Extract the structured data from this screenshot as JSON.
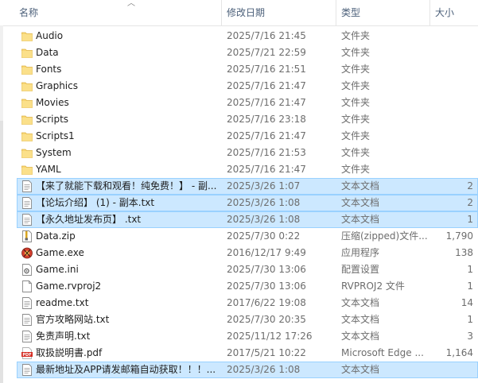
{
  "columns": {
    "name": "名称",
    "date": "修改日期",
    "type": "类型",
    "size": "大小"
  },
  "colors": {
    "selection_fill": "#cce8ff",
    "selection_border": "#99d1ff",
    "folder": "#f8d775",
    "pdf": "#d4281e"
  },
  "files": [
    {
      "name": "Audio",
      "date": "2025/7/16 21:45",
      "type": "文件夹",
      "size": "",
      "icon": "folder-icon",
      "selected": false
    },
    {
      "name": "Data",
      "date": "2025/7/21 22:59",
      "type": "文件夹",
      "size": "",
      "icon": "folder-icon",
      "selected": false
    },
    {
      "name": "Fonts",
      "date": "2025/7/16 21:51",
      "type": "文件夹",
      "size": "",
      "icon": "folder-icon",
      "selected": false
    },
    {
      "name": "Graphics",
      "date": "2025/7/16 21:47",
      "type": "文件夹",
      "size": "",
      "icon": "folder-icon",
      "selected": false
    },
    {
      "name": "Movies",
      "date": "2025/7/16 21:47",
      "type": "文件夹",
      "size": "",
      "icon": "folder-icon",
      "selected": false
    },
    {
      "name": "Scripts",
      "date": "2025/7/16 23:18",
      "type": "文件夹",
      "size": "",
      "icon": "folder-icon",
      "selected": false
    },
    {
      "name": "Scripts1",
      "date": "2025/7/16 21:47",
      "type": "文件夹",
      "size": "",
      "icon": "folder-icon",
      "selected": false
    },
    {
      "name": "System",
      "date": "2025/7/16 21:53",
      "type": "文件夹",
      "size": "",
      "icon": "folder-icon",
      "selected": false
    },
    {
      "name": "YAML",
      "date": "2025/7/16 21:47",
      "type": "文件夹",
      "size": "",
      "icon": "folder-icon",
      "selected": false
    },
    {
      "name": "【来了就能下载和观看！纯免费！】 - 副...",
      "date": "2025/3/26 1:07",
      "type": "文本文档",
      "size": "2",
      "icon": "text-file-icon",
      "selected": true
    },
    {
      "name": "【论坛介绍】 (1) - 副本.txt",
      "date": "2025/3/26 1:08",
      "type": "文本文档",
      "size": "2",
      "icon": "text-file-icon",
      "selected": true
    },
    {
      "name": "【永久地址发布页】 .txt",
      "date": "2025/3/26 1:08",
      "type": "文本文档",
      "size": "1",
      "icon": "text-file-icon",
      "selected": true
    },
    {
      "name": "Data.zip",
      "date": "2025/7/30 0:22",
      "type": "压缩(zipped)文件...",
      "size": "1,790",
      "icon": "zip-file-icon",
      "selected": false
    },
    {
      "name": "Game.exe",
      "date": "2016/12/17 9:49",
      "type": "应用程序",
      "size": "138",
      "icon": "exe-icon",
      "selected": false
    },
    {
      "name": "Game.ini",
      "date": "2025/7/30 13:06",
      "type": "配置设置",
      "size": "1",
      "icon": "ini-file-icon",
      "selected": false
    },
    {
      "name": "Game.rvproj2",
      "date": "2025/7/30 13:06",
      "type": "RVPROJ2 文件",
      "size": "1",
      "icon": "generic-file-icon",
      "selected": false
    },
    {
      "name": "readme.txt",
      "date": "2017/6/22 19:08",
      "type": "文本文档",
      "size": "14",
      "icon": "text-file-icon",
      "selected": false
    },
    {
      "name": "官方攻略网站.txt",
      "date": "2025/7/30 20:35",
      "type": "文本文档",
      "size": "1",
      "icon": "text-file-icon",
      "selected": false
    },
    {
      "name": "免责声明.txt",
      "date": "2025/11/12 17:26",
      "type": "文本文档",
      "size": "3",
      "icon": "text-file-icon",
      "selected": false
    },
    {
      "name": "取扱説明書.pdf",
      "date": "2017/5/21 10:22",
      "type": "Microsoft Edge ...",
      "size": "1,164",
      "icon": "pdf-file-icon",
      "selected": false
    },
    {
      "name": "最新地址及APP请发邮箱自动获取！！！...",
      "date": "2025/3/26 1:08",
      "type": "文本文档",
      "size": "",
      "icon": "text-file-icon",
      "selected": true
    }
  ]
}
